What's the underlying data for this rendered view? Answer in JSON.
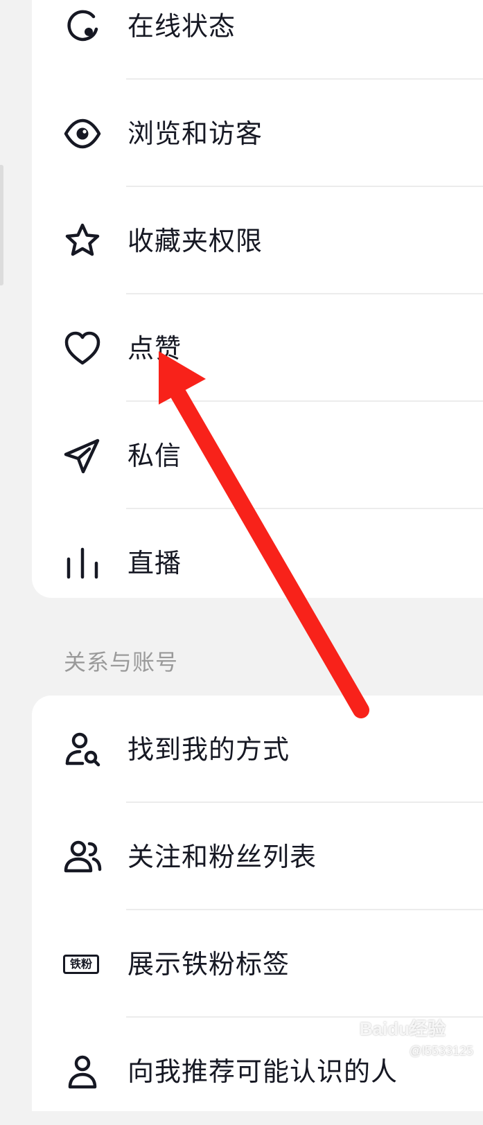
{
  "colors": {
    "background": "#f2f2f2",
    "card": "#ffffff",
    "text": "#161823",
    "section_title": "#9a9a9a",
    "divider": "#ececec",
    "annotation_arrow": "#f8221a"
  },
  "privacy_items": [
    {
      "label": "在线状态",
      "icon": "online-status-icon"
    },
    {
      "label": "浏览和访客",
      "icon": "eye-icon"
    },
    {
      "label": "收藏夹权限",
      "icon": "star-icon"
    },
    {
      "label": "点赞",
      "icon": "heart-icon"
    },
    {
      "label": "私信",
      "icon": "paper-plane-icon"
    },
    {
      "label": "直播",
      "icon": "live-bars-icon"
    }
  ],
  "relations_section": {
    "title": "关系与账号",
    "items": [
      {
        "label": "找到我的方式",
        "icon": "user-search-icon"
      },
      {
        "label": "关注和粉丝列表",
        "icon": "users-icon"
      },
      {
        "label": "展示铁粉标签",
        "icon": "tiefen-badge-icon",
        "badge_text": "铁粉"
      },
      {
        "label": "向我推荐可能认识的人",
        "icon": "user-icon"
      }
    ]
  },
  "watermark": {
    "brand": "Baidu经验",
    "handle": "@l5533125"
  }
}
